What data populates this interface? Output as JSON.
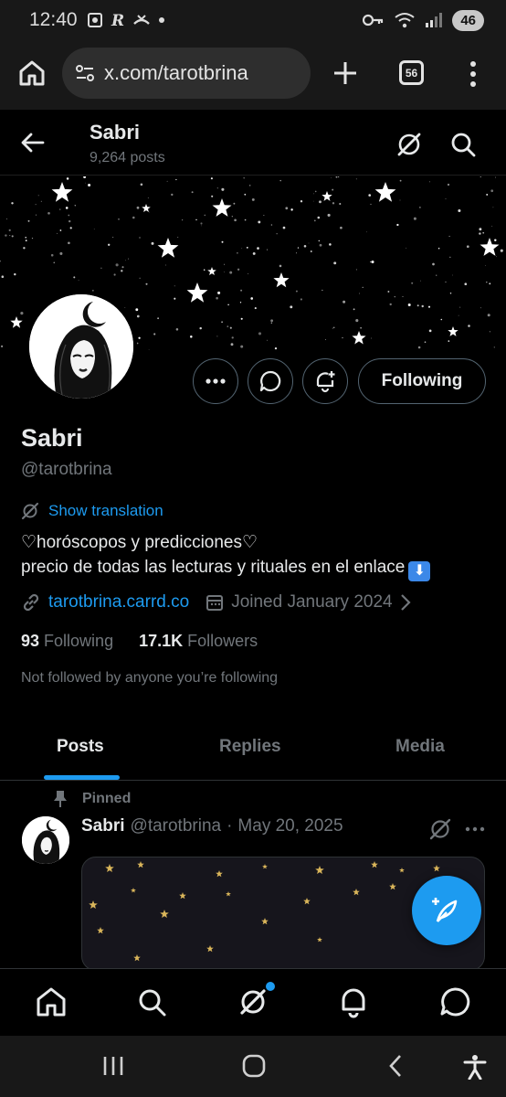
{
  "status_bar": {
    "time": "12:40",
    "battery": "46"
  },
  "browser": {
    "url": "x.com/tarotbrina",
    "tab_count": "56"
  },
  "header": {
    "name": "Sabri",
    "posts": "9,264 posts"
  },
  "profile": {
    "display_name": "Sabri",
    "handle": "@tarotbrina",
    "show_translation": "Show translation",
    "bio_line1": "♡horóscopos y predicciones♡",
    "bio_line2": "precio de todas las lecturas y rituales en el enlace",
    "bio_emoji": "⬇",
    "link": "tarotbrina.carrd.co",
    "joined": "Joined January 2024",
    "following_count": "93",
    "following_label": "Following",
    "followers_count": "17.1K",
    "followers_label": "Followers",
    "not_followed": "Not followed by anyone you’re following",
    "following_button": "Following"
  },
  "tabs": [
    {
      "label": "Posts",
      "active": true
    },
    {
      "label": "Replies",
      "active": false
    },
    {
      "label": "Media",
      "active": false
    }
  ],
  "post": {
    "pinned_label": "Pinned",
    "author": "Sabri",
    "handle": "@tarotbrina",
    "separator": "·",
    "date": "May 20, 2025"
  },
  "colors": {
    "accent": "#1d9bf0",
    "muted": "#71767b",
    "text": "#e7e9ea",
    "border": "#2f3336"
  }
}
